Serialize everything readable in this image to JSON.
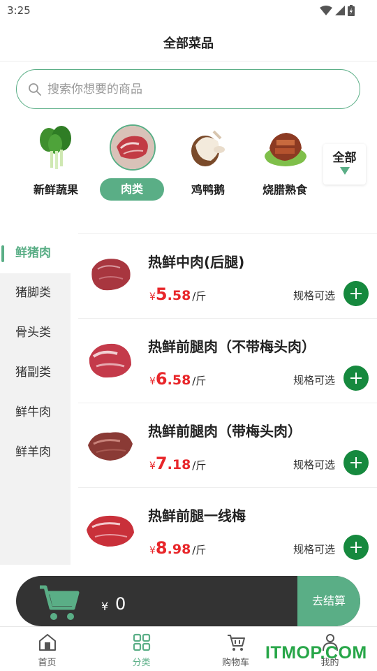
{
  "status_bar": {
    "time": "3:25"
  },
  "header": {
    "title": "全部菜品"
  },
  "search": {
    "placeholder": "搜索你想要的商品"
  },
  "categories": [
    {
      "label": "新鲜蔬果",
      "active": false,
      "icon": "vegetables-image"
    },
    {
      "label": "肉类",
      "active": true,
      "icon": "meat-image"
    },
    {
      "label": "鸡鸭鹅",
      "active": false,
      "icon": "poultry-image"
    },
    {
      "label": "烧腊熟食",
      "active": false,
      "icon": "cured-meat-image"
    }
  ],
  "all_toggle": {
    "label": "全部"
  },
  "sidebar": {
    "items": [
      {
        "label": "鲜猪肉",
        "active": true
      },
      {
        "label": "猪脚类",
        "active": false
      },
      {
        "label": "骨头类",
        "active": false
      },
      {
        "label": "猪副类",
        "active": false
      },
      {
        "label": "鲜牛肉",
        "active": false
      },
      {
        "label": "鲜羊肉",
        "active": false
      }
    ]
  },
  "products": [
    {
      "name": "热鲜中肉(后腿)",
      "currency": "¥",
      "price_int": "5",
      "price_dec": ".58",
      "unit": "/斤",
      "spec": "规格可选"
    },
    {
      "name": "热鲜前腿肉（不带梅头肉）",
      "currency": "¥",
      "price_int": "6",
      "price_dec": ".58",
      "unit": "/斤",
      "spec": "规格可选"
    },
    {
      "name": "热鲜前腿肉（带梅头肉）",
      "currency": "¥",
      "price_int": "7",
      "price_dec": ".18",
      "unit": "/斤",
      "spec": "规格可选"
    },
    {
      "name": "热鲜前腿一线梅",
      "currency": "¥",
      "price_int": "8",
      "price_dec": ".98",
      "unit": "/斤",
      "spec": "规格可选"
    }
  ],
  "cart": {
    "currency": "¥",
    "total": "0",
    "checkout_label": "去结算"
  },
  "tabbar": {
    "items": [
      {
        "label": "首页",
        "active": false
      },
      {
        "label": "分类",
        "active": true
      },
      {
        "label": "购物车",
        "active": false
      },
      {
        "label": "我的",
        "active": false
      }
    ]
  },
  "watermark": {
    "text": "ITMOP.COM"
  },
  "colors": {
    "accent": "#5aae86",
    "price_red": "#e8262a",
    "add_button_green": "#16893e",
    "cart_bar": "#333333"
  }
}
